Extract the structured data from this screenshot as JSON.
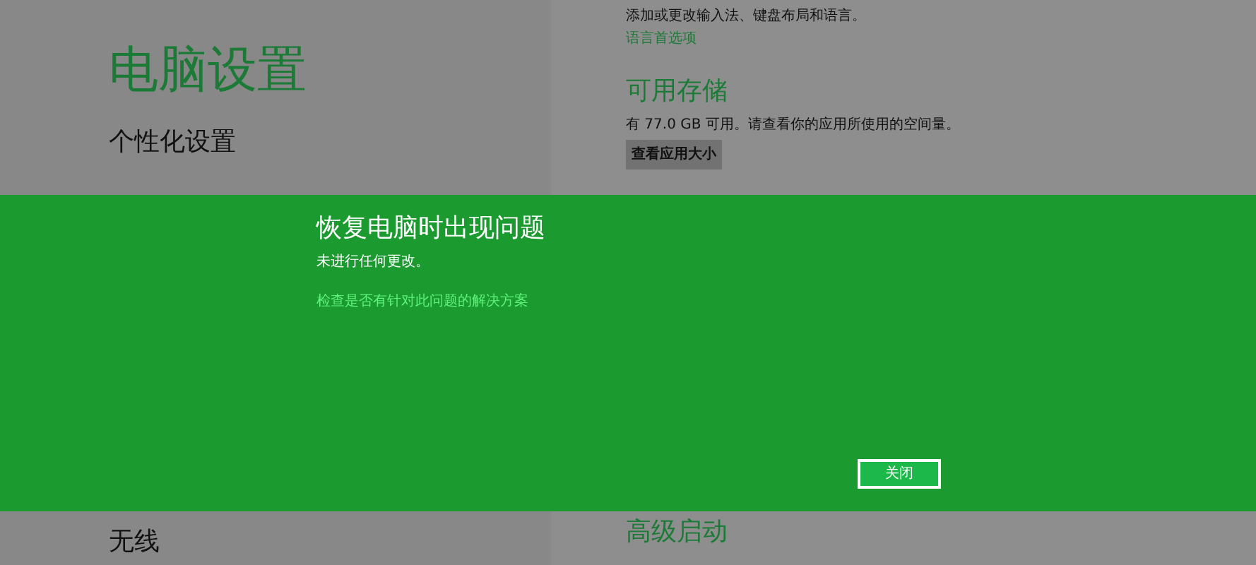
{
  "sidebar": {
    "title": "电脑设置",
    "items": [
      {
        "label": "个性化设置"
      },
      {
        "label": "无线"
      }
    ]
  },
  "content": {
    "language_text": "添加或更改输入法、键盘布局和语言。",
    "language_link": "语言首选项",
    "storage": {
      "heading": "可用存储",
      "text": "有 77.0 GB 可用。请查看你的应用所使用的空间量。",
      "button": "查看应用大小"
    },
    "advanced_heading": "高级启动"
  },
  "dialog": {
    "title": "恢复电脑时出现问题",
    "message": "未进行任何更改。",
    "link": "检查是否有针对此问题的解决方案",
    "button": "关闭"
  }
}
